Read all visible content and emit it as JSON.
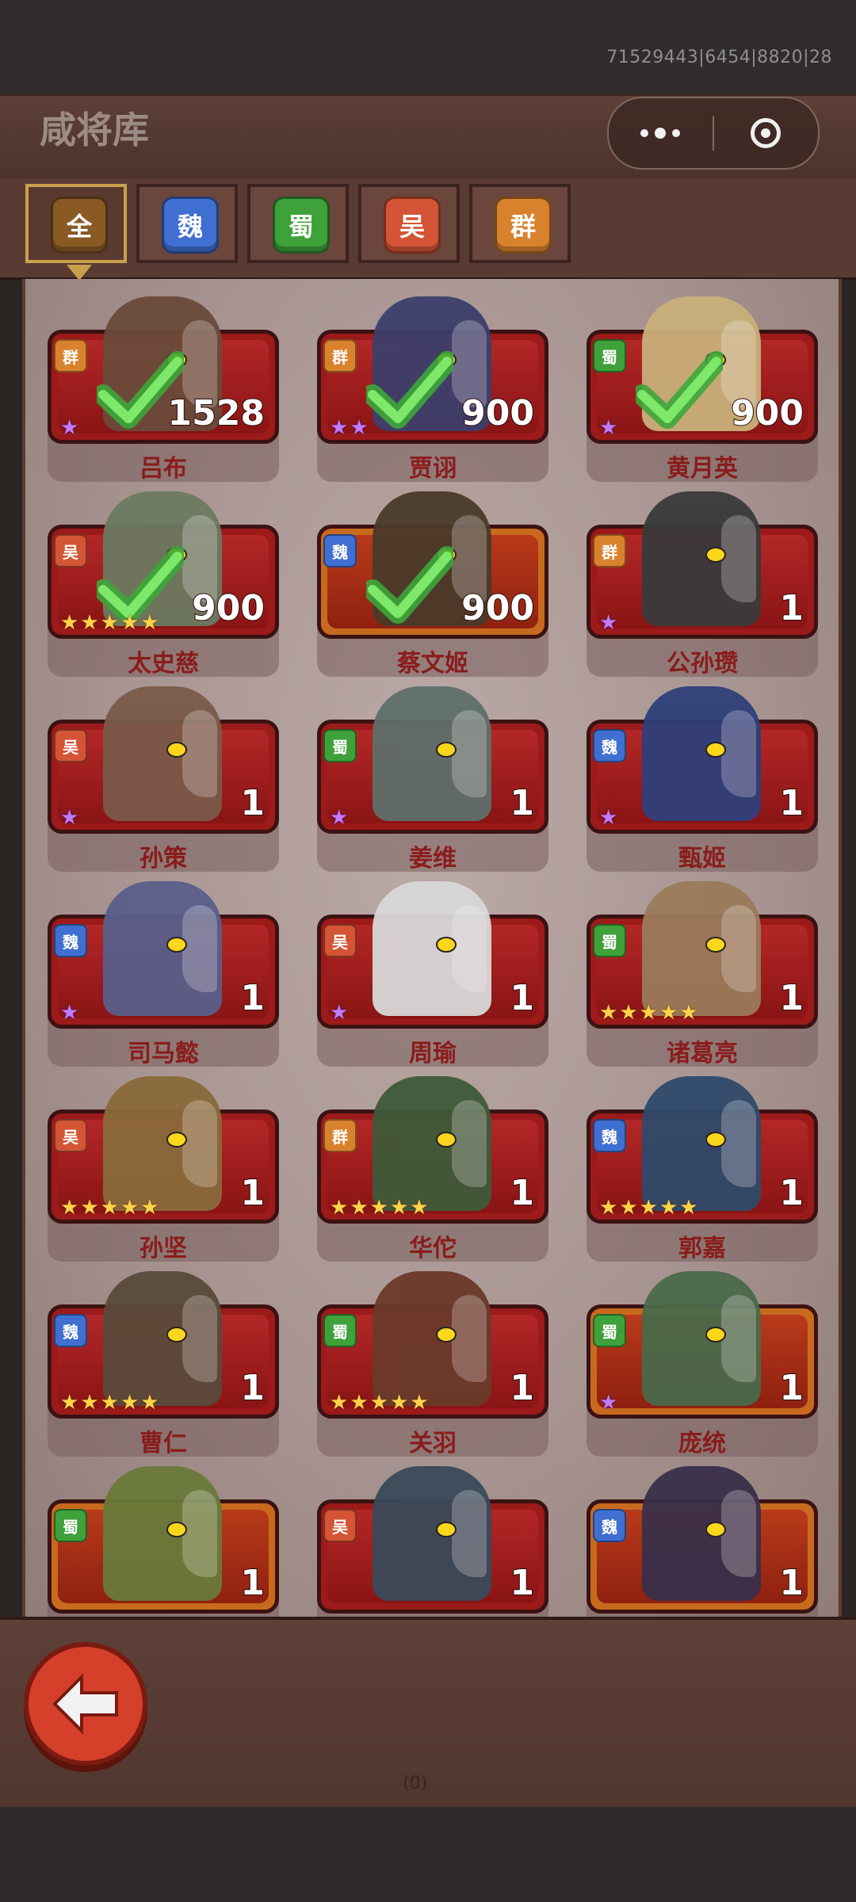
{
  "debug_id": "71529443|6454|8820|28",
  "header": {
    "title": "咸将库"
  },
  "tabs": [
    {
      "label": "全",
      "color": "#8a5a25",
      "active": true
    },
    {
      "label": "魏",
      "color": "#3f6fd1",
      "active": false
    },
    {
      "label": "蜀",
      "color": "#3ea13a",
      "active": false
    },
    {
      "label": "吴",
      "color": "#d35536",
      "active": false
    },
    {
      "label": "群",
      "color": "#d9822e",
      "active": false
    }
  ],
  "faction_colors": {
    "群": "#d9822e",
    "蜀": "#3ea13a",
    "吴": "#d35536",
    "魏": "#3f6fd1"
  },
  "heroes": [
    {
      "name": "吕布",
      "faction": "群",
      "count": "1528",
      "stars": 1,
      "star_color": "purple",
      "checked": true,
      "frame": "red"
    },
    {
      "name": "贾诩",
      "faction": "群",
      "count": "900",
      "stars": 2,
      "star_color": "purple",
      "checked": true,
      "frame": "red"
    },
    {
      "name": "黄月英",
      "faction": "蜀",
      "count": "900",
      "stars": 1,
      "star_color": "purple",
      "checked": true,
      "frame": "red"
    },
    {
      "name": "太史慈",
      "faction": "吴",
      "count": "900",
      "stars": 5,
      "star_color": "gold",
      "checked": true,
      "frame": "red"
    },
    {
      "name": "蔡文姬",
      "faction": "魏",
      "count": "900",
      "stars": 0,
      "star_color": "gold",
      "checked": true,
      "frame": "gold"
    },
    {
      "name": "公孙瓒",
      "faction": "群",
      "count": "1",
      "stars": 1,
      "star_color": "purple",
      "checked": false,
      "frame": "red"
    },
    {
      "name": "孙策",
      "faction": "吴",
      "count": "1",
      "stars": 1,
      "star_color": "purple",
      "checked": false,
      "frame": "red"
    },
    {
      "name": "姜维",
      "faction": "蜀",
      "count": "1",
      "stars": 1,
      "star_color": "purple",
      "checked": false,
      "frame": "red"
    },
    {
      "name": "甄姬",
      "faction": "魏",
      "count": "1",
      "stars": 1,
      "star_color": "purple",
      "checked": false,
      "frame": "red"
    },
    {
      "name": "司马懿",
      "faction": "魏",
      "count": "1",
      "stars": 1,
      "star_color": "purple",
      "checked": false,
      "frame": "red"
    },
    {
      "name": "周瑜",
      "faction": "吴",
      "count": "1",
      "stars": 1,
      "star_color": "purple",
      "checked": false,
      "frame": "red"
    },
    {
      "name": "诸葛亮",
      "faction": "蜀",
      "count": "1",
      "stars": 5,
      "star_color": "gold",
      "checked": false,
      "frame": "red"
    },
    {
      "name": "孙坚",
      "faction": "吴",
      "count": "1",
      "stars": 5,
      "star_color": "gold",
      "checked": false,
      "frame": "red"
    },
    {
      "name": "华佗",
      "faction": "群",
      "count": "1",
      "stars": 5,
      "star_color": "gold",
      "checked": false,
      "frame": "red"
    },
    {
      "name": "郭嘉",
      "faction": "魏",
      "count": "1",
      "stars": 5,
      "star_color": "gold",
      "checked": false,
      "frame": "red"
    },
    {
      "name": "曹仁",
      "faction": "魏",
      "count": "1",
      "stars": 5,
      "star_color": "gold",
      "checked": false,
      "frame": "red"
    },
    {
      "name": "关羽",
      "faction": "蜀",
      "count": "1",
      "stars": 5,
      "star_color": "gold",
      "checked": false,
      "frame": "red"
    },
    {
      "name": "庞统",
      "faction": "蜀",
      "count": "1",
      "stars": 1,
      "star_color": "purple",
      "checked": false,
      "frame": "gold"
    },
    {
      "name": "",
      "faction": "蜀",
      "count": "1",
      "stars": 0,
      "star_color": "gold",
      "checked": false,
      "frame": "gold"
    },
    {
      "name": "",
      "faction": "吴",
      "count": "1",
      "stars": 0,
      "star_color": "gold",
      "checked": false,
      "frame": "red"
    },
    {
      "name": "",
      "faction": "魏",
      "count": "1",
      "stars": 0,
      "star_color": "gold",
      "checked": false,
      "frame": "gold"
    }
  ],
  "footer": {
    "label": "(0)"
  }
}
